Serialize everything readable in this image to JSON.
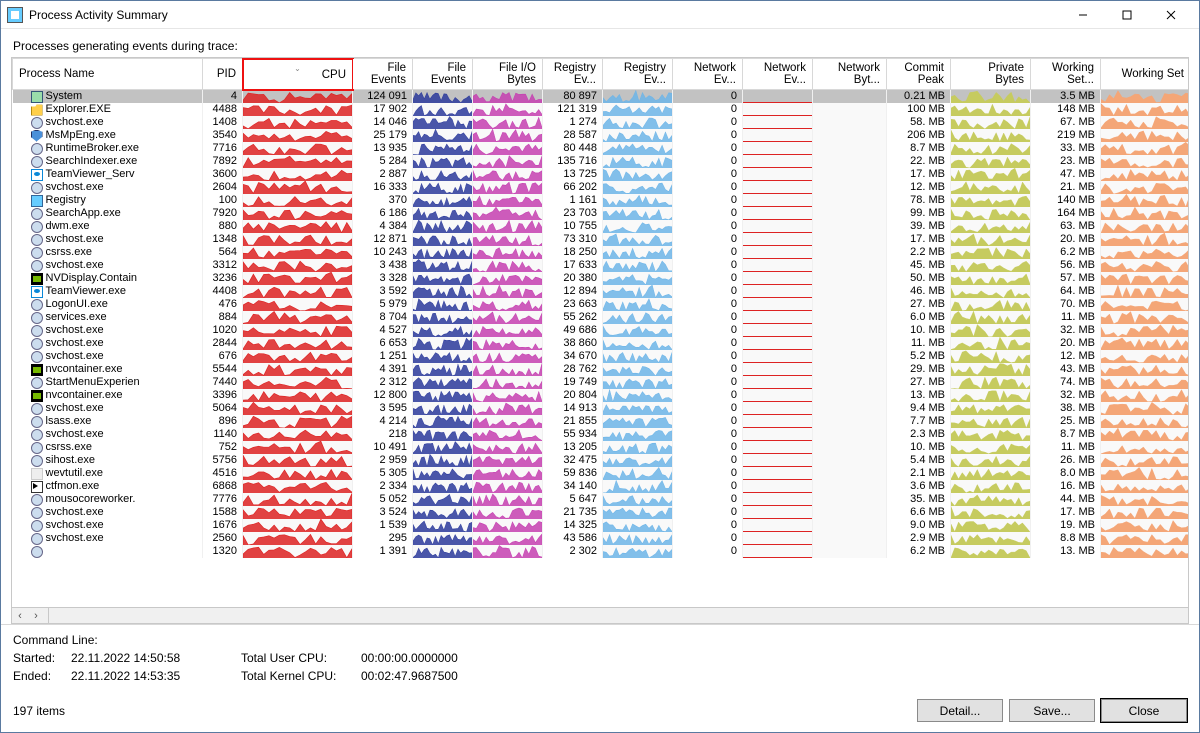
{
  "window": {
    "title": "Process Activity Summary"
  },
  "subheader": "Processes generating events during trace:",
  "columns": {
    "process": "Process Name",
    "pid": "PID",
    "cpu": "CPU",
    "file_events": "File Events",
    "file_events_spark": "File Events",
    "file_io_bytes": "File I/O Bytes",
    "registry_ev": "Registry Ev...",
    "registry_ev_spark": "Registry Ev...",
    "network_ev": "Network Ev...",
    "network_ev_spark": "Network Ev...",
    "network_bytes": "Network Byt...",
    "commit_peak": "Commit Peak",
    "private_bytes": "Private Bytes",
    "working_set": "Working Set...",
    "working_set2": "Working Set"
  },
  "rows": [
    {
      "name": "System",
      "pid": "4",
      "icon": "sys",
      "file_events": "124 091",
      "registry": "80 897",
      "network": "0",
      "commit": "0.21 MB",
      "workingset": "3.5 MB",
      "selected": true
    },
    {
      "name": "Explorer.EXE",
      "pid": "4488",
      "icon": "folder",
      "file_events": "17 902",
      "registry": "121 319",
      "network": "0",
      "commit": "100 MB",
      "workingset": "148 MB"
    },
    {
      "name": "svchost.exe",
      "pid": "1408",
      "icon": "gear",
      "file_events": "14 046",
      "registry": "1 274",
      "network": "0",
      "commit": "58. MB",
      "workingset": "67. MB"
    },
    {
      "name": "MsMpEng.exe",
      "pid": "3540",
      "icon": "shield",
      "file_events": "25 179",
      "registry": "28 587",
      "network": "0",
      "commit": "206 MB",
      "workingset": "219 MB"
    },
    {
      "name": "RuntimeBroker.exe",
      "pid": "7716",
      "icon": "gear",
      "file_events": "13 935",
      "registry": "80 448",
      "network": "0",
      "commit": "8.7 MB",
      "workingset": "33. MB"
    },
    {
      "name": "SearchIndexer.exe",
      "pid": "7892",
      "icon": "gear",
      "file_events": "5 284",
      "registry": "135 716",
      "network": "0",
      "commit": "22. MB",
      "workingset": "23. MB"
    },
    {
      "name": "TeamViewer_Serv",
      "pid": "3600",
      "icon": "tv",
      "file_events": "2 887",
      "registry": "13 725",
      "network": "0",
      "commit": "17. MB",
      "workingset": "47. MB"
    },
    {
      "name": "svchost.exe",
      "pid": "2604",
      "icon": "gear",
      "file_events": "16 333",
      "registry": "66 202",
      "network": "0",
      "commit": "12. MB",
      "workingset": "21. MB"
    },
    {
      "name": "Registry",
      "pid": "100",
      "icon": "reg",
      "file_events": "370",
      "registry": "1 161",
      "network": "0",
      "commit": "78. MB",
      "workingset": "140 MB"
    },
    {
      "name": "SearchApp.exe",
      "pid": "7920",
      "icon": "gear",
      "file_events": "6 186",
      "registry": "23 703",
      "network": "0",
      "commit": "99. MB",
      "workingset": "164 MB"
    },
    {
      "name": "dwm.exe",
      "pid": "880",
      "icon": "gear",
      "file_events": "4 384",
      "registry": "10 755",
      "network": "0",
      "commit": "39. MB",
      "workingset": "63. MB"
    },
    {
      "name": "svchost.exe",
      "pid": "1348",
      "icon": "gear",
      "file_events": "12 871",
      "registry": "73 310",
      "network": "0",
      "commit": "17. MB",
      "workingset": "20. MB"
    },
    {
      "name": "csrss.exe",
      "pid": "564",
      "icon": "gear",
      "file_events": "10 243",
      "registry": "18 250",
      "network": "0",
      "commit": "2.2 MB",
      "workingset": "6.2 MB"
    },
    {
      "name": "svchost.exe",
      "pid": "3312",
      "icon": "gear",
      "file_events": "3 438",
      "registry": "17 633",
      "network": "0",
      "commit": "45. MB",
      "workingset": "56. MB"
    },
    {
      "name": "NVDisplay.Contain",
      "pid": "3236",
      "icon": "nv",
      "file_events": "3 328",
      "registry": "20 380",
      "network": "0",
      "commit": "50. MB",
      "workingset": "57. MB"
    },
    {
      "name": "TeamViewer.exe",
      "pid": "4408",
      "icon": "tv",
      "file_events": "3 592",
      "registry": "12 894",
      "network": "0",
      "commit": "46. MB",
      "workingset": "64. MB"
    },
    {
      "name": "LogonUI.exe",
      "pid": "476",
      "icon": "gear",
      "file_events": "5 979",
      "registry": "23 663",
      "network": "0",
      "commit": "27. MB",
      "workingset": "70. MB"
    },
    {
      "name": "services.exe",
      "pid": "884",
      "icon": "gear",
      "file_events": "8 704",
      "registry": "55 262",
      "network": "0",
      "commit": "6.0 MB",
      "workingset": "11. MB"
    },
    {
      "name": "svchost.exe",
      "pid": "1020",
      "icon": "gear",
      "file_events": "4 527",
      "registry": "49 686",
      "network": "0",
      "commit": "10. MB",
      "workingset": "32. MB"
    },
    {
      "name": "svchost.exe",
      "pid": "2844",
      "icon": "gear",
      "file_events": "6 653",
      "registry": "38 860",
      "network": "0",
      "commit": "11. MB",
      "workingset": "20. MB"
    },
    {
      "name": "svchost.exe",
      "pid": "676",
      "icon": "gear",
      "file_events": "1 251",
      "registry": "34 670",
      "network": "0",
      "commit": "5.2 MB",
      "workingset": "12. MB"
    },
    {
      "name": "nvcontainer.exe",
      "pid": "5544",
      "icon": "nv",
      "file_events": "4 391",
      "registry": "28 762",
      "network": "0",
      "commit": "29. MB",
      "workingset": "43. MB"
    },
    {
      "name": "StartMenuExperien",
      "pid": "7440",
      "icon": "gear",
      "file_events": "2 312",
      "registry": "19 749",
      "network": "0",
      "commit": "27. MB",
      "workingset": "74. MB"
    },
    {
      "name": "nvcontainer.exe",
      "pid": "3396",
      "icon": "nv",
      "file_events": "12 800",
      "registry": "20 804",
      "network": "0",
      "commit": "13. MB",
      "workingset": "32. MB"
    },
    {
      "name": "svchost.exe",
      "pid": "5064",
      "icon": "gear",
      "file_events": "3 595",
      "registry": "14 913",
      "network": "0",
      "commit": "9.4 MB",
      "workingset": "38. MB"
    },
    {
      "name": "lsass.exe",
      "pid": "896",
      "icon": "gear",
      "file_events": "4 214",
      "registry": "21 855",
      "network": "0",
      "commit": "7.7 MB",
      "workingset": "25. MB"
    },
    {
      "name": "svchost.exe",
      "pid": "1140",
      "icon": "gear",
      "file_events": "218",
      "registry": "55 934",
      "network": "0",
      "commit": "2.3 MB",
      "workingset": "8.7 MB"
    },
    {
      "name": "csrss.exe",
      "pid": "752",
      "icon": "gear",
      "file_events": "10 491",
      "registry": "13 205",
      "network": "0",
      "commit": "10. MB",
      "workingset": "11. MB"
    },
    {
      "name": "sihost.exe",
      "pid": "5756",
      "icon": "gear",
      "file_events": "2 959",
      "registry": "32 475",
      "network": "0",
      "commit": "5.4 MB",
      "workingset": "26. MB"
    },
    {
      "name": "wevtutil.exe",
      "pid": "4516",
      "icon": "none",
      "file_events": "5 305",
      "registry": "59 836",
      "network": "0",
      "commit": "2.1 MB",
      "workingset": "8.0 MB"
    },
    {
      "name": "ctfmon.exe",
      "pid": "6868",
      "icon": "cur",
      "file_events": "2 334",
      "registry": "34 140",
      "network": "0",
      "commit": "3.6 MB",
      "workingset": "16. MB"
    },
    {
      "name": "mousocoreworker.",
      "pid": "7776",
      "icon": "gear",
      "file_events": "5 052",
      "registry": "5 647",
      "network": "0",
      "commit": "35. MB",
      "workingset": "44. MB"
    },
    {
      "name": "svchost.exe",
      "pid": "1588",
      "icon": "gear",
      "file_events": "3 524",
      "registry": "21 735",
      "network": "0",
      "commit": "6.6 MB",
      "workingset": "17. MB"
    },
    {
      "name": "svchost.exe",
      "pid": "1676",
      "icon": "gear",
      "file_events": "1 539",
      "registry": "14 325",
      "network": "0",
      "commit": "9.0 MB",
      "workingset": "19. MB"
    },
    {
      "name": "svchost.exe",
      "pid": "2560",
      "icon": "gear",
      "file_events": "295",
      "registry": "43 586",
      "network": "0",
      "commit": "2.9 MB",
      "workingset": "8.8 MB"
    },
    {
      "name": "",
      "pid": "1320",
      "icon": "gear",
      "file_events": "1 391",
      "registry": "2 302",
      "network": "0",
      "commit": "6.2 MB",
      "workingset": "13. MB"
    }
  ],
  "footer": {
    "command_line_label": "Command Line:",
    "started_label": "Started:",
    "started_value": "22.11.2022 14:50:58",
    "ended_label": "Ended:",
    "ended_value": "22.11.2022 14:53:35",
    "total_user_cpu_label": "Total User CPU:",
    "total_user_cpu_value": "00:00:00.0000000",
    "total_kernel_cpu_label": "Total Kernel CPU:",
    "total_kernel_cpu_value": "00:02:47.9687500"
  },
  "actions": {
    "count": "197 items",
    "detail": "Detail...",
    "save": "Save...",
    "close": "Close"
  },
  "spark_colors": {
    "cpu": "#d22",
    "file": "#2b3a9b",
    "fio": "#c53fb0",
    "reg": "#6db5e8",
    "net": "#d22",
    "priv": "#c6cb5f",
    "ws": "#f4a677"
  }
}
